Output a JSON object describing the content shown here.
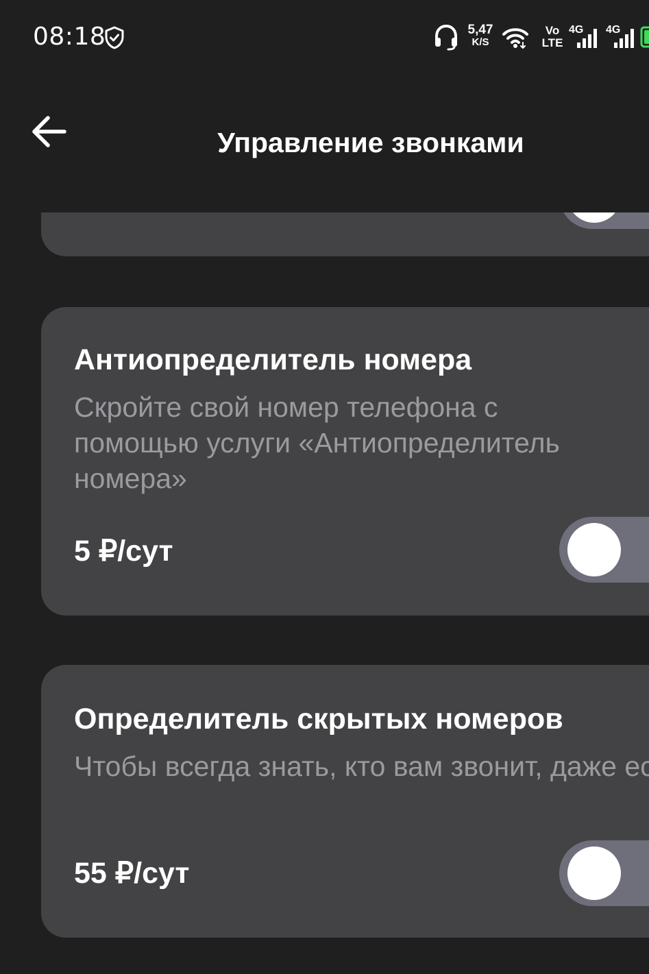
{
  "status_bar": {
    "time": "08:18",
    "net_speed_value": "5,47",
    "net_speed_unit": "K/S",
    "volte_top": "Vo",
    "volte_bottom": "LTE",
    "sim1_label": "4G",
    "sim2_label": "4G",
    "icons": [
      "shield-icon",
      "headset-icon",
      "wifi-icon",
      "signal-icon",
      "battery-icon"
    ],
    "battery_color": "#3ddc5a"
  },
  "header": {
    "title": "Управление звонками",
    "back_icon": "arrow-left-icon"
  },
  "colors": {
    "background": "#1f1f20",
    "card": "#434345",
    "description_text": "#9a9a9f",
    "toggle_off_track": "#6f6f7b"
  },
  "services": [
    {
      "title": "Антиопределитель номера",
      "description": "Скройте свой номер телефона с\nпомощью услуги «Антиопределитель\nномера»",
      "price": "5 ₽/сут",
      "enabled": false
    },
    {
      "title": "Определитель скрытых номеров",
      "description": "Чтобы всегда знать, кто вам звонит, даже\nесли у них антиопределитель номера",
      "price": "55 ₽/сут",
      "enabled": false
    }
  ]
}
